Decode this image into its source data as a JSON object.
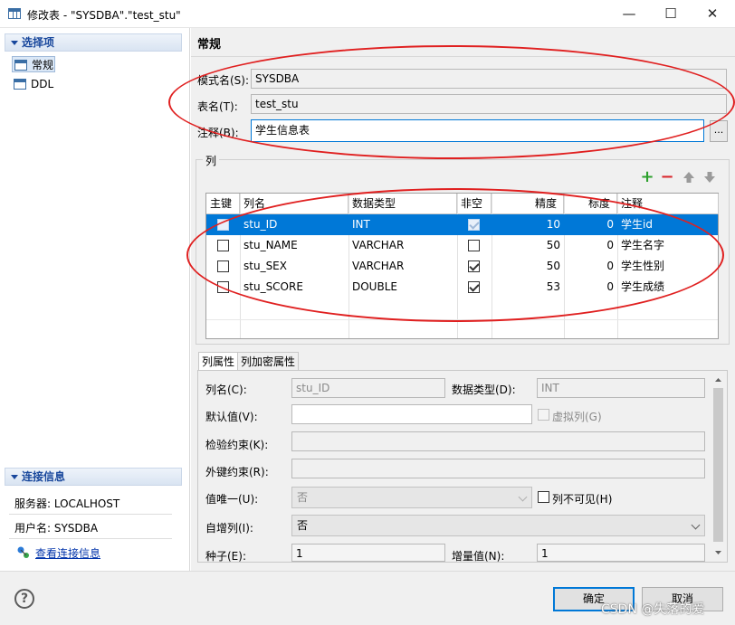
{
  "window": {
    "title": "修改表 - \"SYSDBA\".\"test_stu\"",
    "minimize": "—",
    "maximize": "☐",
    "close": "✕"
  },
  "sidebar": {
    "header": "选择项",
    "items": [
      {
        "label": "常规",
        "selected": true
      },
      {
        "label": "DDL",
        "selected": false
      }
    ],
    "conn_header": "连接信息",
    "server": "服务器: LOCALHOST",
    "user": "用户名: SYSDBA",
    "view_link": "查看连接信息"
  },
  "general": {
    "section_title": "常规",
    "schema_label": "模式名(S):",
    "schema_value": "SYSDBA",
    "table_label": "表名(T):",
    "table_value": "test_stu",
    "comment_label": "注释(B):",
    "comment_value": "学生信息表",
    "dots": "..."
  },
  "columns": {
    "group_label": "列",
    "headers": [
      "主键",
      "列名",
      "数据类型",
      "非空",
      "精度",
      "标度",
      "注释"
    ],
    "rows": [
      {
        "pk": false,
        "name": "stu_ID",
        "type": "INT",
        "notnull": true,
        "precision": "10",
        "scale": "0",
        "comment": "学生id"
      },
      {
        "pk": false,
        "name": "stu_NAME",
        "type": "VARCHAR",
        "notnull": false,
        "precision": "50",
        "scale": "0",
        "comment": "学生名字"
      },
      {
        "pk": false,
        "name": "stu_SEX",
        "type": "VARCHAR",
        "notnull": true,
        "precision": "50",
        "scale": "0",
        "comment": "学生性别"
      },
      {
        "pk": false,
        "name": "stu_SCORE",
        "type": "DOUBLE",
        "notnull": true,
        "precision": "53",
        "scale": "0",
        "comment": "学生成绩"
      }
    ],
    "toolbar": {
      "add": "+",
      "remove": "−",
      "up": "🡅",
      "down": "🡇"
    }
  },
  "props": {
    "tabs": [
      "列属性",
      "列加密属性"
    ],
    "colname_label": "列名(C):",
    "colname_value": "stu_ID",
    "datatype_label": "数据类型(D):",
    "datatype_value": "INT",
    "default_label": "默认值(V):",
    "default_value": "",
    "virtual_label": "虚拟列(G)",
    "check_label": "检验约束(K):",
    "fk_label": "外键约束(R):",
    "unique_label": "值唯一(U):",
    "unique_value": "否",
    "invisible_label": "列不可见(H)",
    "autoinc_label": "自增列(I):",
    "autoinc_value": "否",
    "seed_label": "种子(E):",
    "seed_value": "1",
    "increment_label": "增量值(N):",
    "increment_value": "1"
  },
  "footer": {
    "help": "?",
    "ok": "确定",
    "cancel": "取消"
  },
  "watermark": "CSDN @失落的爱",
  "colors": {
    "accent": "#0078d7",
    "annotation": "#e02020",
    "section": "#18479c"
  }
}
